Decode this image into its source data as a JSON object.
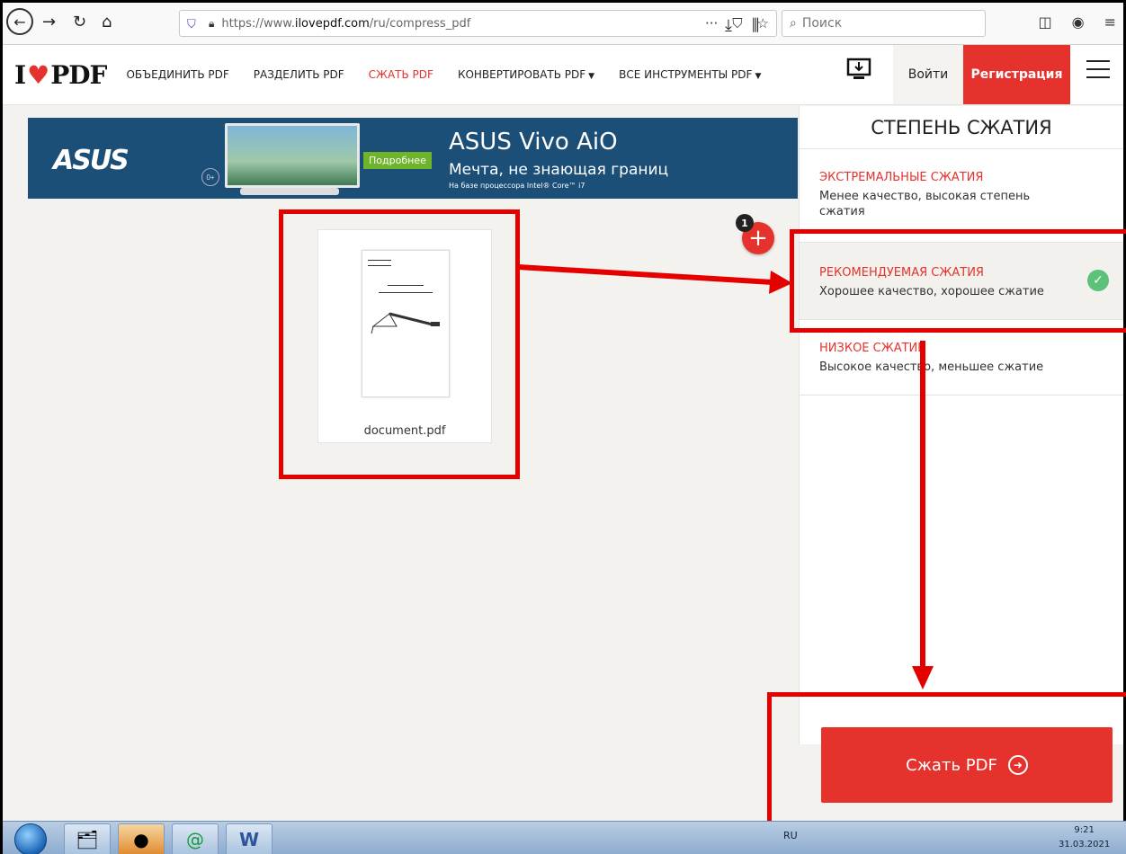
{
  "browser": {
    "url_prefix": "https://www.",
    "url_domain": "ilovepdf.com",
    "url_path": "/ru/compress_pdf",
    "search_placeholder": "Поиск"
  },
  "header": {
    "logo_left": "I",
    "logo_right": "PDF",
    "nav": {
      "merge": "ОБЪЕДИНИТЬ PDF",
      "split": "РАЗДЕЛИТЬ PDF",
      "compress": "СЖАТЬ PDF",
      "convert": "КОНВЕРТИРОВАТЬ PDF",
      "all_tools": "ВСЕ ИНСТРУМЕНТЫ PDF"
    },
    "login": "Войти",
    "signup": "Регистрация"
  },
  "ad": {
    "brand": "ASUS",
    "age": "0+",
    "more": "Подробнее",
    "title": "ASUS Vivo AiO",
    "tagline": "Мечта, не знающая границ",
    "small": "На базе процессора Intel® Core™ i7"
  },
  "file": {
    "name": "document.pdf",
    "count": "1"
  },
  "sidebar": {
    "title": "СТЕПЕНЬ СЖАТИЯ",
    "options": [
      {
        "title": "ЭКСТРЕМАЛЬНЫЕ СЖАТИЯ",
        "desc": "Менее качество, высокая степень сжатия"
      },
      {
        "title": "РЕКОМЕНДУЕМАЯ СЖАТИЯ",
        "desc": "Хорошее качество, хорошее сжатие"
      },
      {
        "title": "НИЗКОЕ СЖАТИЕ",
        "desc": "Высокое качество, меньшее сжатие"
      }
    ],
    "selected_index": 1,
    "action": "Сжать PDF"
  },
  "taskbar": {
    "lang": "RU",
    "time": "9:21",
    "date": "31.03.2021"
  },
  "colors": {
    "brand_red": "#e5322d",
    "annotation_red": "#e50000",
    "check_green": "#5cc27a"
  }
}
